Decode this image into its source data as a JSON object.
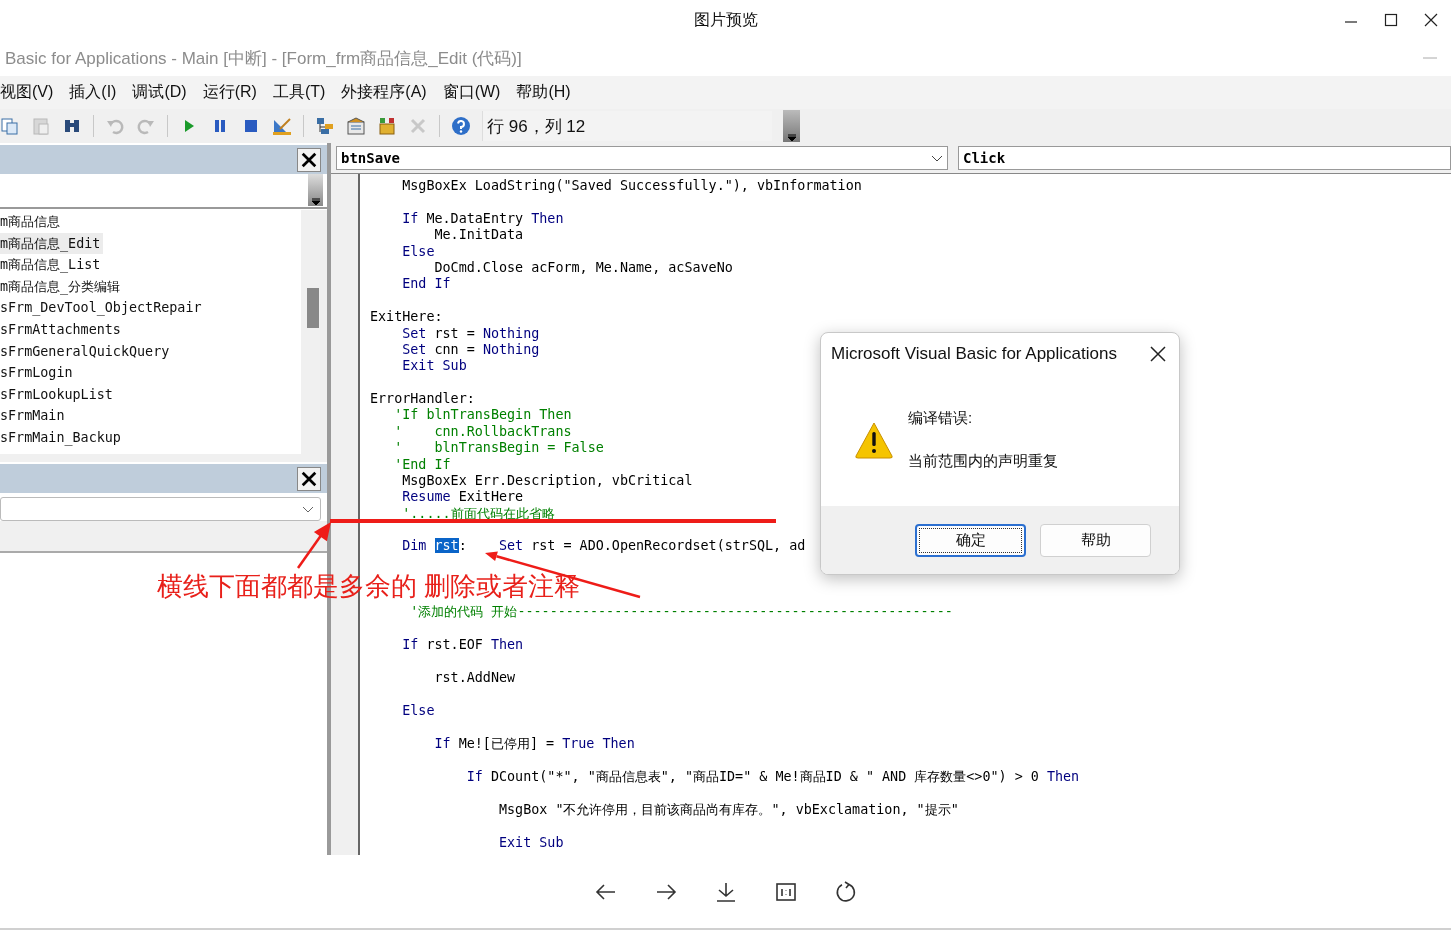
{
  "viewer": {
    "title": "图片预览"
  },
  "vbe": {
    "title": "Basic for Applications - Main [中断] - [Form_frm商品信息_Edit (代码)]",
    "menu": [
      "视图(V)",
      "插入(I)",
      "调试(D)",
      "运行(R)",
      "工具(T)",
      "外接程序(A)",
      "窗口(W)",
      "帮助(H)"
    ],
    "toolbar": {
      "buttons": [
        {
          "kind": "copy",
          "disabled": false
        },
        {
          "kind": "paste",
          "disabled": true
        },
        {
          "kind": "find",
          "disabled": false
        },
        {
          "kind": "separator"
        },
        {
          "kind": "undo",
          "disabled": true
        },
        {
          "kind": "redo",
          "disabled": true
        },
        {
          "kind": "separator"
        },
        {
          "kind": "run",
          "disabled": false
        },
        {
          "kind": "pause",
          "disabled": false
        },
        {
          "kind": "stop",
          "disabled": false
        },
        {
          "kind": "design",
          "disabled": false
        },
        {
          "kind": "separator"
        },
        {
          "kind": "project",
          "disabled": false
        },
        {
          "kind": "properties",
          "disabled": false
        },
        {
          "kind": "browser",
          "disabled": false
        },
        {
          "kind": "toolbox",
          "disabled": true
        },
        {
          "kind": "separator"
        },
        {
          "kind": "help",
          "disabled": false
        }
      ],
      "position": "行 96，列 12"
    },
    "project_panel": {
      "items": [
        {
          "label": "m商品信息",
          "selected": false
        },
        {
          "label": "m商品信息_Edit",
          "selected": true
        },
        {
          "label": "m商品信息_List",
          "selected": false
        },
        {
          "label": "m商品信息_分类编辑",
          "selected": false
        },
        {
          "label": "sFrm_DevTool_ObjectRepair",
          "selected": false
        },
        {
          "label": "sFrmAttachments",
          "selected": false
        },
        {
          "label": "sFrmGeneralQuickQuery",
          "selected": false
        },
        {
          "label": "sFrmLogin",
          "selected": false
        },
        {
          "label": "sFrmLookupList",
          "selected": false
        },
        {
          "label": "sFrmMain",
          "selected": false
        },
        {
          "label": "sFrmMain_Backup",
          "selected": false
        }
      ]
    },
    "code": {
      "object": "btnSave",
      "procedure": "Click",
      "sections": [
        {
          "blocks": [
            [
              [
                {
                  "text": "    MsgBoxEx LoadString(\"Saved Successfully.\"), vbInformation",
                  "kind": "plain"
                }
              ]
            ],
            [
              [
                {
                  "text": "    If",
                  "kind": "keyword"
                },
                {
                  "text": " Me.DataEntry ",
                  "kind": "plain"
                },
                {
                  "text": "Then",
                  "kind": "keyword"
                }
              ],
              [
                {
                  "text": "        Me.InitData",
                  "kind": "plain"
                }
              ],
              [
                {
                  "text": "    Else",
                  "kind": "keyword"
                }
              ],
              [
                {
                  "text": "        DoCmd.Close acForm, Me.Name, acSaveNo",
                  "kind": "plain"
                }
              ],
              [
                {
                  "text": "    End If",
                  "kind": "keyword"
                }
              ]
            ],
            [
              [
                {
                  "text": "ExitHere:",
                  "kind": "plain"
                }
              ],
              [
                {
                  "text": "    Set",
                  "kind": "keyword"
                },
                {
                  "text": " rst = ",
                  "kind": "plain"
                },
                {
                  "text": "Nothing",
                  "kind": "keyword"
                }
              ],
              [
                {
                  "text": "    Set",
                  "kind": "keyword"
                },
                {
                  "text": " cnn = ",
                  "kind": "plain"
                },
                {
                  "text": "Nothing",
                  "kind": "keyword"
                }
              ],
              [
                {
                  "text": "    Exit Sub",
                  "kind": "keyword"
                }
              ]
            ],
            [
              [
                {
                  "text": "ErrorHandler:",
                  "kind": "plain"
                }
              ],
              [
                {
                  "text": "   'If blnTransBegin Then",
                  "kind": "comment"
                }
              ],
              [
                {
                  "text": "   '    cnn.RollbackTrans",
                  "kind": "comment"
                }
              ],
              [
                {
                  "text": "   '    blnTransBegin = False",
                  "kind": "comment"
                }
              ],
              [
                {
                  "text": "   'End If",
                  "kind": "comment"
                }
              ],
              [
                {
                  "text": "    MsgBoxEx Err.Description, vbCritical",
                  "kind": "plain"
                }
              ],
              [
                {
                  "text": "    Resume",
                  "kind": "keyword"
                },
                {
                  "text": " ExitHere",
                  "kind": "plain"
                }
              ],
              [
                {
                  "text": "    '.....前面代码在此省略",
                  "kind": "comment"
                }
              ]
            ]
          ]
        },
        {
          "blocks": [
            [
              [
                {
                  "text": "    Dim ",
                  "kind": "keyword"
                },
                {
                  "text": "rst",
                  "kind": "selected"
                },
                {
                  "text": ":    ",
                  "kind": "plain"
                },
                {
                  "text": "Set",
                  "kind": "keyword"
                },
                {
                  "text": " rst = ADO.OpenRecordset(strSQL, ad",
                  "kind": "plain"
                }
              ]
            ],
            [
              [
                {
                  "text": "     '添加的代码 开始------------------------------------------------------",
                  "kind": "comment"
                }
              ],
              [
                {
                  "text": "    If",
                  "kind": "keyword"
                },
                {
                  "text": " rst.EOF ",
                  "kind": "plain"
                },
                {
                  "text": "Then",
                  "kind": "keyword"
                }
              ],
              [
                {
                  "text": "        rst.AddNew",
                  "kind": "plain"
                }
              ],
              [
                {
                  "text": "    Else",
                  "kind": "keyword"
                }
              ],
              [
                {
                  "text": "        If",
                  "kind": "keyword"
                },
                {
                  "text": " Me![已停用] = ",
                  "kind": "plain"
                },
                {
                  "text": "True Then",
                  "kind": "keyword"
                }
              ],
              [
                {
                  "text": "            If",
                  "kind": "keyword"
                },
                {
                  "text": " DCount(\"*\", \"商品信息表\", \"商品ID=\" & Me!商品ID & \" AND 库存数量<>0\") > 0 ",
                  "kind": "plain"
                },
                {
                  "text": "Then",
                  "kind": "keyword"
                }
              ],
              [
                {
                  "text": "                MsgBox \"不允许停用，目前该商品尚有库存。\", vbExclamation, \"提示\"",
                  "kind": "plain"
                }
              ],
              [
                {
                  "text": "                Exit Sub",
                  "kind": "keyword"
                }
              ]
            ]
          ]
        }
      ]
    }
  },
  "dialog": {
    "title": "Microsoft Visual Basic for Applications",
    "heading": "编译错误:",
    "message": "当前范围内的声明重复",
    "buttons": [
      {
        "label": "确定",
        "default": true
      },
      {
        "label": "帮助",
        "default": false
      }
    ]
  },
  "annotation": {
    "text": "横线下面都都是多余的 删除或者注释"
  }
}
